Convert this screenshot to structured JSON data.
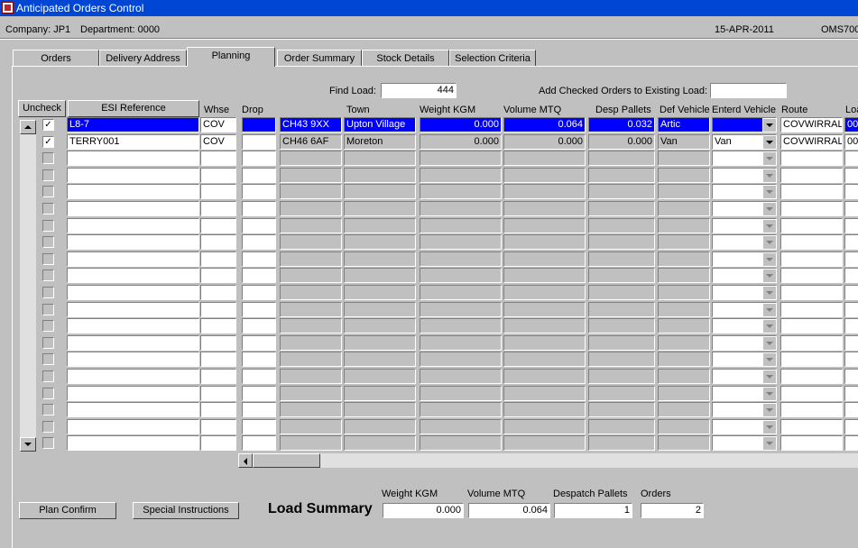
{
  "window": {
    "title": "Anticipated Orders Control"
  },
  "info": {
    "company": "Company:  JP1",
    "department": "Department:  0000",
    "date": "15-APR-2011",
    "screen_code": "OMS700"
  },
  "tabs": [
    "Orders",
    "Delivery Address",
    "Planning",
    "Order Summary",
    "Stock Details",
    "Selection Criteria"
  ],
  "active_tab": "Planning",
  "find_load": {
    "label": "Find Load:",
    "value": "444"
  },
  "add_checked": {
    "label": "Add Checked Orders to Existing Load:",
    "value": ""
  },
  "columns": {
    "uncheck": "Uncheck",
    "esi_reference": "ESI Reference",
    "whse": "Whse",
    "drop": "Drop",
    "town": "Town",
    "weight": "Weight KGM",
    "volume": "Volume MTQ",
    "pallets": "Desp Pallets",
    "def_vehicle": "Def Vehicle",
    "entered_vehicle": "Enterd Vehicle",
    "route": "Route",
    "load": "Loa"
  },
  "rows": [
    {
      "checked": true,
      "esi_reference": "L8-7",
      "whse": "COV",
      "drop": "",
      "postcode": "CH43 9XX",
      "town": "Upton Village",
      "weight": "0.000",
      "volume": "0.064",
      "pallets": "0.032",
      "def_vehicle": "Artic",
      "entered_vehicle": "",
      "route": "COVWIRRAL",
      "load": "00",
      "selected": true
    },
    {
      "checked": true,
      "esi_reference": "TERRY001",
      "whse": "COV",
      "drop": "",
      "postcode": "CH46 6AF",
      "town": "Moreton",
      "weight": "0.000",
      "volume": "0.000",
      "pallets": "0.000",
      "def_vehicle": "Van",
      "entered_vehicle": "Van",
      "route": "COVWIRRAL",
      "load": "00",
      "selected": false
    }
  ],
  "buttons": {
    "plan_confirm": "Plan Confirm",
    "special_instructions": "Special Instructions"
  },
  "summary": {
    "title": "Load Summary",
    "weight_label": "Weight KGM",
    "weight": "0.000",
    "volume_label": "Volume MTQ",
    "volume": "0.064",
    "pallets_label": "Despatch Pallets",
    "pallets": "1",
    "orders_label": "Orders",
    "orders": "2"
  },
  "colors": {
    "title_bar": "#0046d5",
    "selection": "#0000ff",
    "window_bg": "#c0c0c0"
  },
  "icons": [
    "app-icon",
    "scroll-up-icon",
    "scroll-down-icon",
    "scroll-left-icon",
    "dropdown-arrow-icon"
  ]
}
